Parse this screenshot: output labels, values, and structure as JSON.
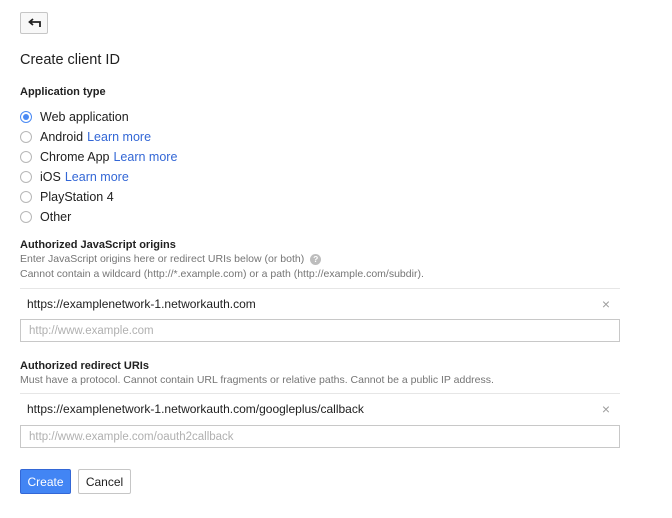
{
  "page": {
    "title": "Create client ID"
  },
  "application_type": {
    "label": "Application type",
    "options": [
      {
        "label": "Web application",
        "link": "",
        "checked": true
      },
      {
        "label": "Android",
        "link": "Learn more",
        "checked": false
      },
      {
        "label": "Chrome App",
        "link": "Learn more",
        "checked": false
      },
      {
        "label": "iOS",
        "link": "Learn more",
        "checked": false
      },
      {
        "label": "PlayStation 4",
        "link": "",
        "checked": false
      },
      {
        "label": "Other",
        "link": "",
        "checked": false
      }
    ]
  },
  "js_origins": {
    "label": "Authorized JavaScript origins",
    "hint1": "Enter JavaScript origins here or redirect URIs below (or both)",
    "help_icon": "?",
    "hint2": "Cannot contain a wildcard (http://*.example.com) or a path (http://example.com/subdir).",
    "value": "https://examplenetwork-1.networkauth.com",
    "remove_glyph": "×",
    "placeholder": "http://www.example.com"
  },
  "redirect_uris": {
    "label": "Authorized redirect URIs",
    "hint": "Must have a protocol. Cannot contain URL fragments or relative paths. Cannot be a public IP address.",
    "value": "https://examplenetwork-1.networkauth.com/googleplus/callback",
    "remove_glyph": "×",
    "placeholder": "http://www.example.com/oauth2callback"
  },
  "actions": {
    "create_label": "Create",
    "cancel_label": "Cancel"
  },
  "icons": {
    "back": "back-arrow-icon",
    "help": "help-icon",
    "remove": "close-icon"
  },
  "colors": {
    "accent": "#4285f4",
    "link": "#3367d6",
    "text": "#212121",
    "hint": "#757575"
  }
}
